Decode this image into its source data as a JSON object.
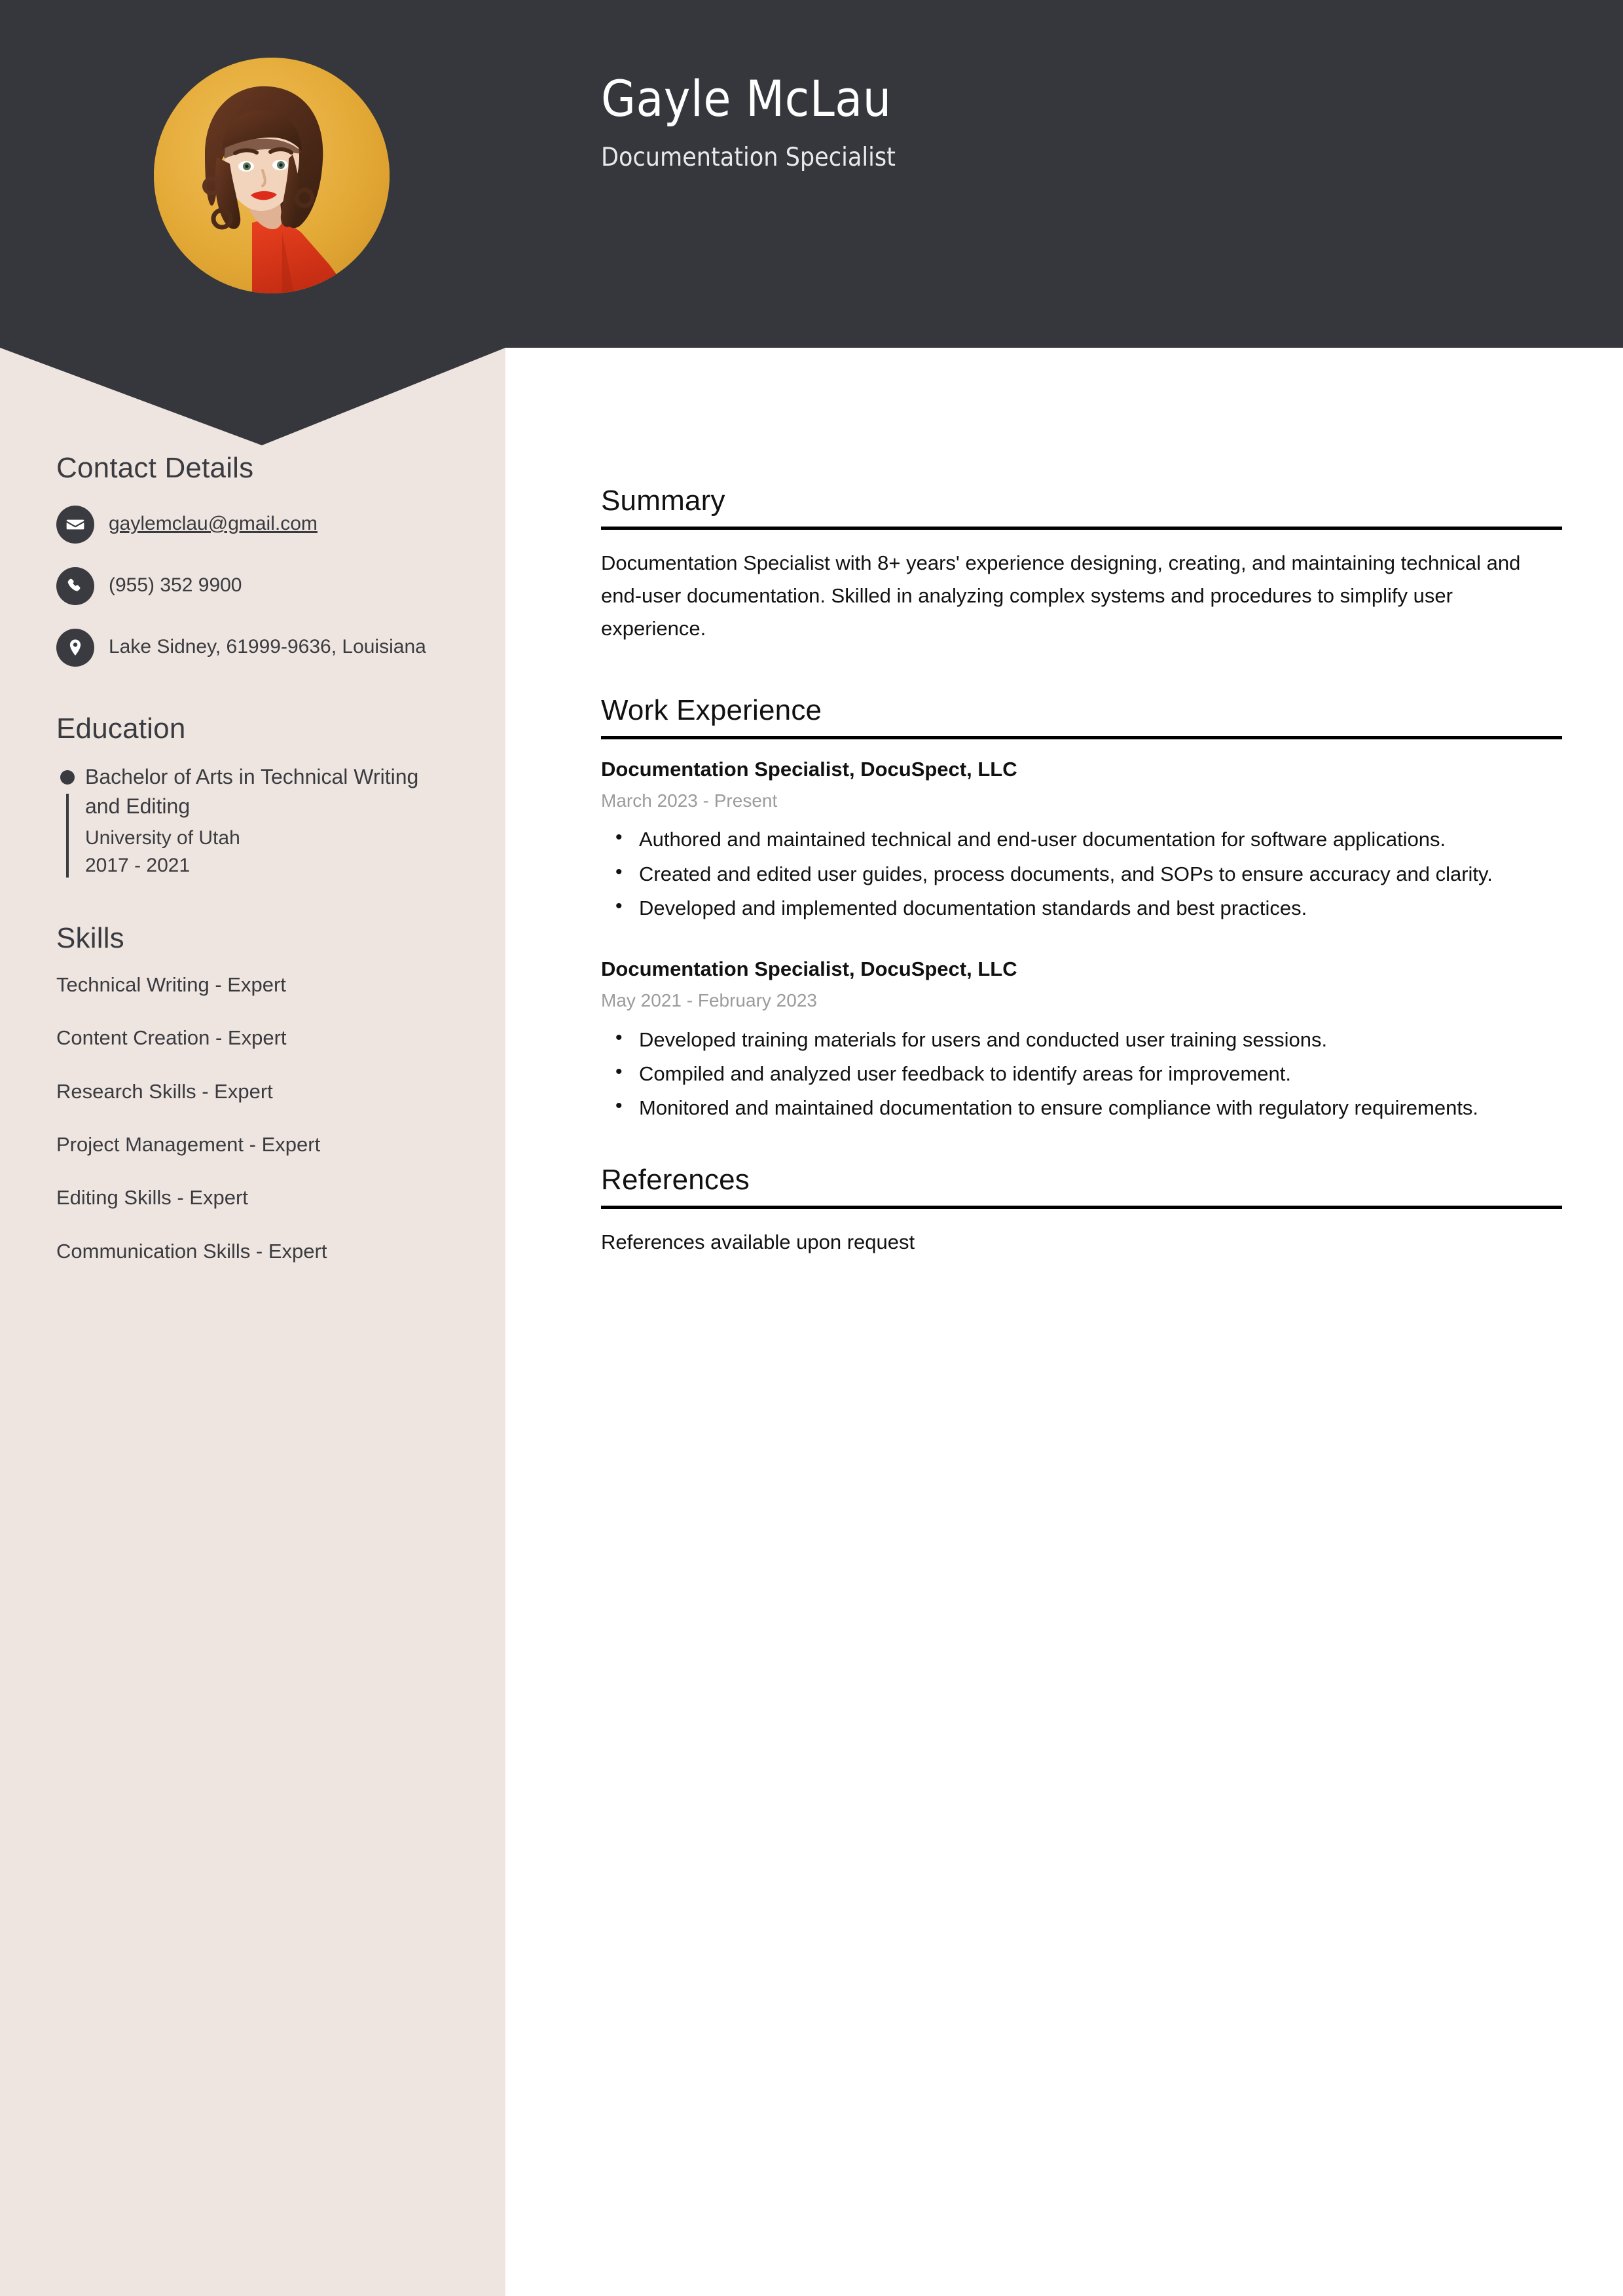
{
  "header": {
    "name": "Gayle McLau",
    "job_title": "Documentation Specialist",
    "avatar_alt": "profile-photo",
    "bg_color": "#36373c",
    "avatar_bg_color": "#e0a33a"
  },
  "sidebar": {
    "bg_color": "#eee5e0",
    "contact": {
      "heading": "Contact Details",
      "items": [
        {
          "icon": "envelope-icon",
          "value": "gaylemclau@gmail.com",
          "link": true
        },
        {
          "icon": "phone-icon",
          "value": "(955) 352 9900",
          "link": false
        },
        {
          "icon": "location-pin-icon",
          "value": "Lake Sidney, 61999-9636, Louisiana",
          "link": false
        }
      ]
    },
    "education": {
      "heading": "Education",
      "entries": [
        {
          "degree": "Bachelor of Arts in Technical Writing and Editing",
          "school": "University of Utah",
          "years": "2017 - 2021"
        }
      ]
    },
    "skills": {
      "heading": "Skills",
      "items": [
        "Technical Writing - Expert",
        "Content Creation - Expert",
        "Research Skills - Expert",
        "Project Management - Expert",
        "Editing Skills - Expert",
        "Communication Skills - Expert"
      ]
    }
  },
  "main": {
    "summary": {
      "heading": "Summary",
      "text": "Documentation Specialist with 8+ years' experience designing, creating, and maintaining technical and end-user documentation. Skilled in analyzing complex systems and procedures to simplify user experience."
    },
    "work_experience": {
      "heading": "Work Experience",
      "jobs": [
        {
          "title": "Documentation Specialist, DocuSpect, LLC",
          "dates": "March 2023 - Present",
          "bullets": [
            "Authored and maintained technical and end-user documentation for software applications.",
            "Created and edited user guides, process documents, and SOPs to ensure accuracy and clarity.",
            "Developed and implemented documentation standards and best practices."
          ]
        },
        {
          "title": "Documentation Specialist, DocuSpect, LLC",
          "dates": "May 2021 - February 2023",
          "bullets": [
            "Developed training materials for users and conducted user training sessions.",
            "Compiled and analyzed user feedback to identify areas for improvement.",
            "Monitored and maintained documentation to ensure compliance with regulatory requirements."
          ]
        }
      ]
    },
    "references": {
      "heading": "References",
      "text": "References available upon request"
    }
  }
}
